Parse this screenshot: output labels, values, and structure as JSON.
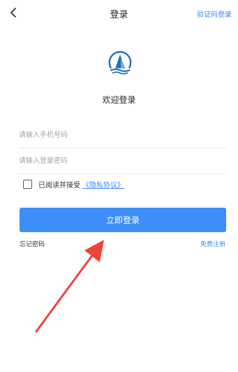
{
  "header": {
    "title": "登录",
    "right_link": "验证码登录",
    "back_icon": "chevron-left-icon"
  },
  "logo": {
    "icon": "sailboat-logo",
    "color": "#1f6fb5"
  },
  "welcome": "欢迎登录",
  "form": {
    "phone_placeholder": "请输入手机号码",
    "phone_value": "",
    "password_placeholder": "请输入登录密码",
    "password_value": ""
  },
  "agreement": {
    "text": "已阅读并接受",
    "link": "《隐私协议》",
    "checked": false
  },
  "login_button": "立即登录",
  "forgot_password": "忘记密码",
  "register": "免费注册",
  "colors": {
    "accent": "#3d8ef8",
    "link": "#3a8bf5",
    "annotation": "#f0433a"
  },
  "annotation": {
    "icon": "red-arrow-pointing-to-login-button"
  }
}
